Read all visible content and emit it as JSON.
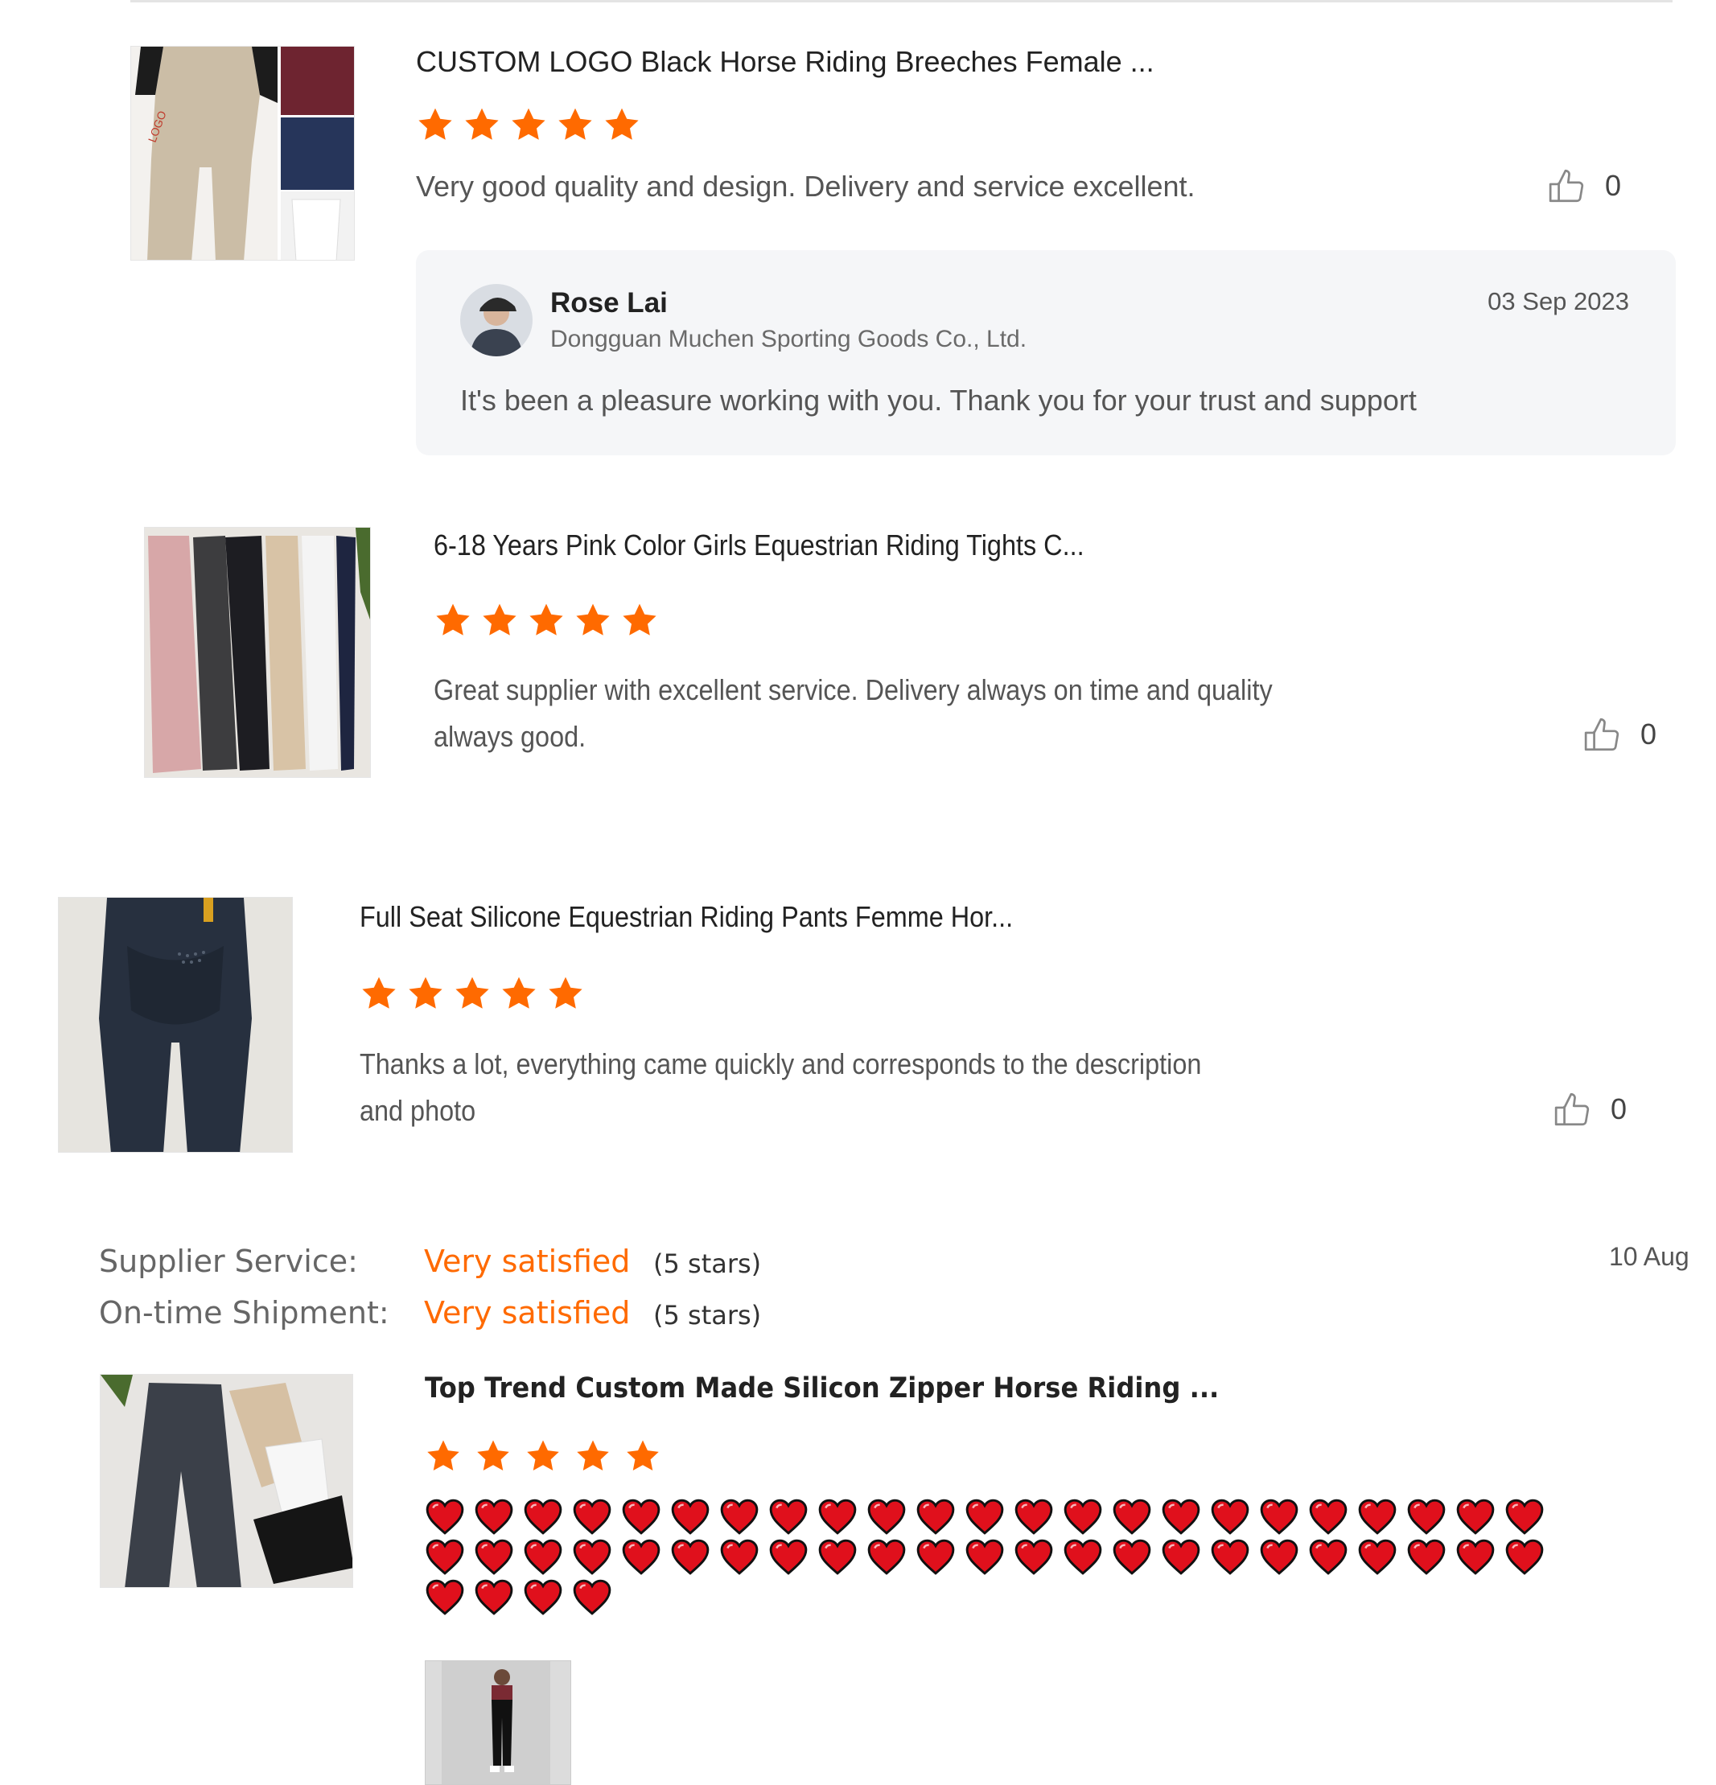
{
  "accent_color": "#ff6a00",
  "heart_color": "#e0101c",
  "reviews": [
    {
      "product_title": "CUSTOM LOGO Black Horse Riding Breeches Female ...",
      "rating": 5,
      "text": "Very good quality and design. Delivery and service excellent.",
      "likes": "0",
      "thumb_logo_text": "LOGO",
      "reply": {
        "name": "Rose Lai",
        "company": "Dongguan Muchen Sporting Goods Co., Ltd.",
        "date": "03 Sep 2023",
        "text": "It's been a pleasure working with you. Thank you for your trust and support"
      }
    },
    {
      "product_title": "6-18 Years Pink Color Girls Equestrian Riding Tights C...",
      "rating": 5,
      "text_line1": "Great supplier with excellent service. Delivery always on time and quality",
      "text_line2": "always good.",
      "likes": "0"
    },
    {
      "product_title": "Full Seat Silicone Equestrian Riding Pants Femme Hor...",
      "rating": 5,
      "text_line1": "Thanks a lot, everything came quickly and corresponds to the description",
      "text_line2": "and photo",
      "likes": "0"
    },
    {
      "supplier_service_label": "Supplier Service:",
      "supplier_service_value": "Very satisfied",
      "supplier_service_stars": "(5 stars)",
      "shipment_label": "On-time Shipment:",
      "shipment_value": "Very satisfied",
      "shipment_stars": "(5 stars)",
      "date": "10 Aug",
      "product_title": "Top Trend Custom Made Silicon Zipper Horse Riding ...",
      "rating": 5,
      "heart_emoji_count": 50
    }
  ]
}
